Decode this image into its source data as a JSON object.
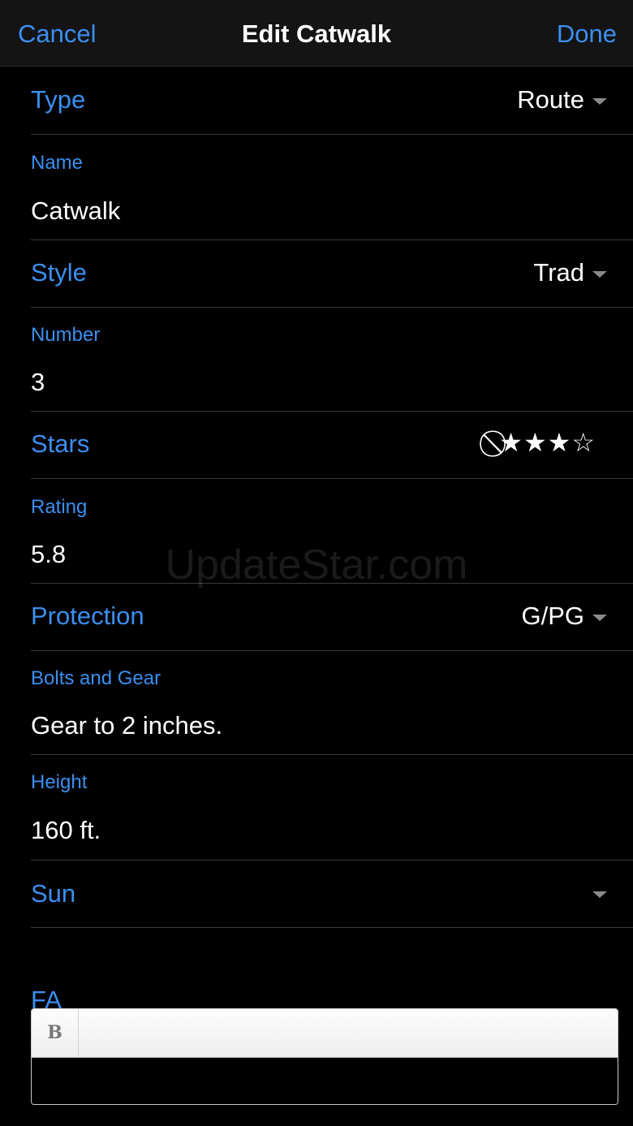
{
  "navbar": {
    "cancel_label": "Cancel",
    "title": "Edit Catwalk",
    "done_label": "Done"
  },
  "fields": {
    "type": {
      "label": "Type",
      "value": "Route"
    },
    "name": {
      "label": "Name",
      "value": "Catwalk"
    },
    "style": {
      "label": "Style",
      "value": "Trad"
    },
    "number": {
      "label": "Number",
      "value": "3"
    },
    "stars": {
      "label": "Stars",
      "rating": 3,
      "max": 4,
      "clear_symbol": "⃠",
      "filled_symbol": "★",
      "empty_symbol": "☆"
    },
    "rating": {
      "label": "Rating",
      "value": "5.8"
    },
    "protection": {
      "label": "Protection",
      "value": "G/PG"
    },
    "bolts_and_gear": {
      "label": "Bolts and Gear",
      "value": "Gear to 2 inches."
    },
    "height": {
      "label": "Height",
      "value": "160 ft."
    },
    "sun": {
      "label": "Sun",
      "value": ""
    },
    "fa": {
      "label": "FA",
      "toolbar_bold_label": "B",
      "value": ""
    }
  },
  "watermark": "UpdateStar.com",
  "colors": {
    "accent": "#3b8ff0",
    "background": "#000000",
    "navbar": "#141414",
    "separator": "#3a3a3a"
  }
}
